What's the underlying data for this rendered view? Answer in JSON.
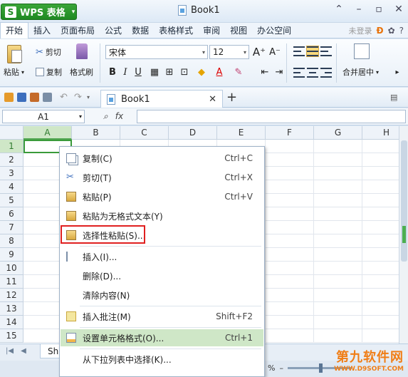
{
  "app": {
    "name": "WPS 表格",
    "logo": "S",
    "doc_title": "Book1"
  },
  "menu": {
    "tabs": [
      "开始",
      "插入",
      "页面布局",
      "公式",
      "数据",
      "表格样式",
      "审阅",
      "视图",
      "办公空间"
    ],
    "login": "未登录",
    "help": "?"
  },
  "ribbon": {
    "paste": "粘贴",
    "cut": "剪切",
    "copy": "复制",
    "format_painter": "格式刷",
    "font": "宋体",
    "font_size": "12",
    "bold": "B",
    "italic": "I",
    "underline": "U",
    "merge_center": "合并居中"
  },
  "doc_tab": {
    "name": "Book1"
  },
  "formula": {
    "cell_ref": "A1",
    "fx": "fx"
  },
  "grid": {
    "columns": [
      "A",
      "B",
      "C",
      "D",
      "E",
      "F",
      "G",
      "H"
    ],
    "rows": [
      "1",
      "2",
      "3",
      "4",
      "5",
      "6",
      "7",
      "8",
      "9",
      "10",
      "11",
      "12",
      "13",
      "14",
      "15"
    ],
    "selected_col": "A",
    "selected_row": "1"
  },
  "sheet": {
    "tab_label": "Sh"
  },
  "status": {
    "zoom_pct": "%"
  },
  "context_menu": {
    "items": [
      {
        "label": "复制(C)",
        "shortcut": "Ctrl+C",
        "icon": "copy-icon"
      },
      {
        "label": "剪切(T)",
        "shortcut": "Ctrl+X",
        "icon": "scissors-icon"
      },
      {
        "label": "粘贴(P)",
        "shortcut": "Ctrl+V",
        "icon": "paste-icon"
      },
      {
        "label": "粘贴为无格式文本(Y)",
        "shortcut": "",
        "icon": "paste-text-icon"
      },
      {
        "label": "选择性粘贴(S)...",
        "shortcut": "",
        "icon": "paste-special-icon"
      },
      {
        "label": "插入(I)...",
        "shortcut": "",
        "icon": "insert-icon"
      },
      {
        "label": "删除(D)...",
        "shortcut": "",
        "icon": ""
      },
      {
        "label": "清除内容(N)",
        "shortcut": "",
        "icon": ""
      },
      {
        "label": "插入批注(M)",
        "shortcut": "Shift+F2",
        "icon": "comment-icon"
      },
      {
        "label": "设置单元格格式(O)...",
        "shortcut": "Ctrl+1",
        "icon": "format-cells-icon"
      },
      {
        "label": "从下拉列表中选择(K)...",
        "shortcut": "",
        "icon": ""
      }
    ]
  },
  "watermark": {
    "line1": "第九软件网",
    "line2": "WWW.D9SOFT.COM"
  },
  "colors": {
    "accent_green": "#2e8b2e",
    "highlight_red": "#e02020"
  }
}
